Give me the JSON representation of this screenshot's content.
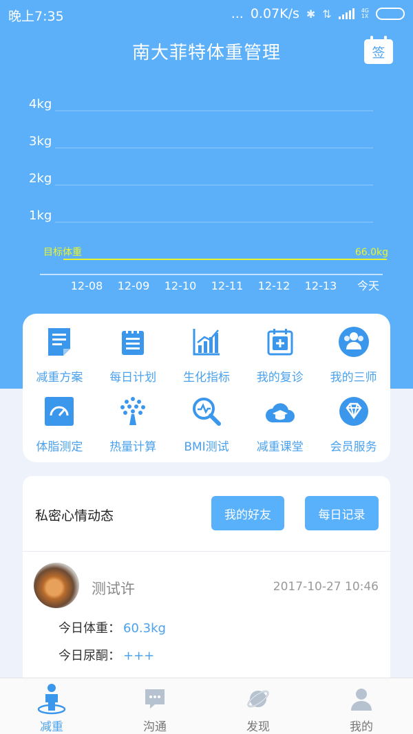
{
  "status_bar": {
    "time": "晚上7:35",
    "dots": "...",
    "speed": "0.07K/s",
    "net_label_top": "4G",
    "net_label_bottom": "1X"
  },
  "header": {
    "title": "南大菲特体重管理",
    "sign_label": "签"
  },
  "colors": {
    "primary": "#5cb0fa",
    "accent_text": "#4aa1ee",
    "target_line": "#e8f52a"
  },
  "chart_data": {
    "type": "line",
    "y_ticks": [
      "4kg",
      "3kg",
      "2kg",
      "1kg"
    ],
    "categories": [
      "12-08",
      "12-09",
      "12-10",
      "12-11",
      "12-12",
      "12-13",
      "今天"
    ],
    "target_label": "目标体重",
    "target_value_label": "66.0kg",
    "grid": true
  },
  "menu": [
    {
      "label": "减重方案",
      "icon": "document-icon"
    },
    {
      "label": "每日计划",
      "icon": "notepad-icon"
    },
    {
      "label": "生化指标",
      "icon": "bar-chart-icon"
    },
    {
      "label": "我的复诊",
      "icon": "medical-calendar-icon"
    },
    {
      "label": "我的三师",
      "icon": "team-icon"
    },
    {
      "label": "体脂测定",
      "icon": "gauge-icon"
    },
    {
      "label": "热量计算",
      "icon": "tree-dots-icon"
    },
    {
      "label": "BMI测试",
      "icon": "magnifier-pulse-icon"
    },
    {
      "label": "减重课堂",
      "icon": "cloud-graduation-icon"
    },
    {
      "label": "会员服务",
      "icon": "diamond-icon"
    }
  ],
  "mood": {
    "title": "私密心情动态",
    "friends_button": "我的好友",
    "daily_button": "每日记录"
  },
  "post": {
    "user": "测试许",
    "time": "2017-10-27 10:46",
    "weight_label": "今日体重：",
    "weight_value": "60.3kg",
    "ketone_label": "今日尿酮：",
    "ketone_value": "+++"
  },
  "tabs": [
    {
      "label": "减重",
      "icon": "person-scale-icon",
      "active": true
    },
    {
      "label": "沟通",
      "icon": "chat-icon",
      "active": false
    },
    {
      "label": "发现",
      "icon": "planet-icon",
      "active": false
    },
    {
      "label": "我的",
      "icon": "user-icon",
      "active": false
    }
  ]
}
